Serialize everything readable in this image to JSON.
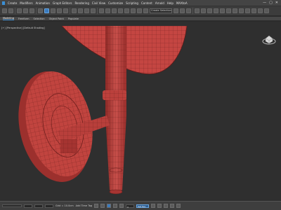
{
  "menu": {
    "items": [
      "Create",
      "Modifiers",
      "Animation",
      "Graph Editors",
      "Rendering",
      "Civil View",
      "Customize",
      "Scripting",
      "Content",
      "Arnold",
      "Help",
      "MAXtoA"
    ],
    "window_controls": [
      "—",
      "▢",
      "✕"
    ]
  },
  "toolbar": {
    "selection_set": "Create Selection Set"
  },
  "ribbon": {
    "tabs": [
      "Modeling",
      "Freeform",
      "Selection",
      "Object Paint",
      "Populate"
    ],
    "active_tab": "Modeling"
  },
  "viewport": {
    "label": "[+] [Perspective] [Default Shading]",
    "viewcube_icon": "viewcube-compass-icon",
    "model_color": "#c0413e",
    "wire_color": "#6e1f1d",
    "background": "#2f2f2f"
  },
  "status": {
    "grid": "Grid = 10.0cm",
    "add_time_tag": "Add Time Tag",
    "frame": "0",
    "set_key": "Set Key"
  }
}
